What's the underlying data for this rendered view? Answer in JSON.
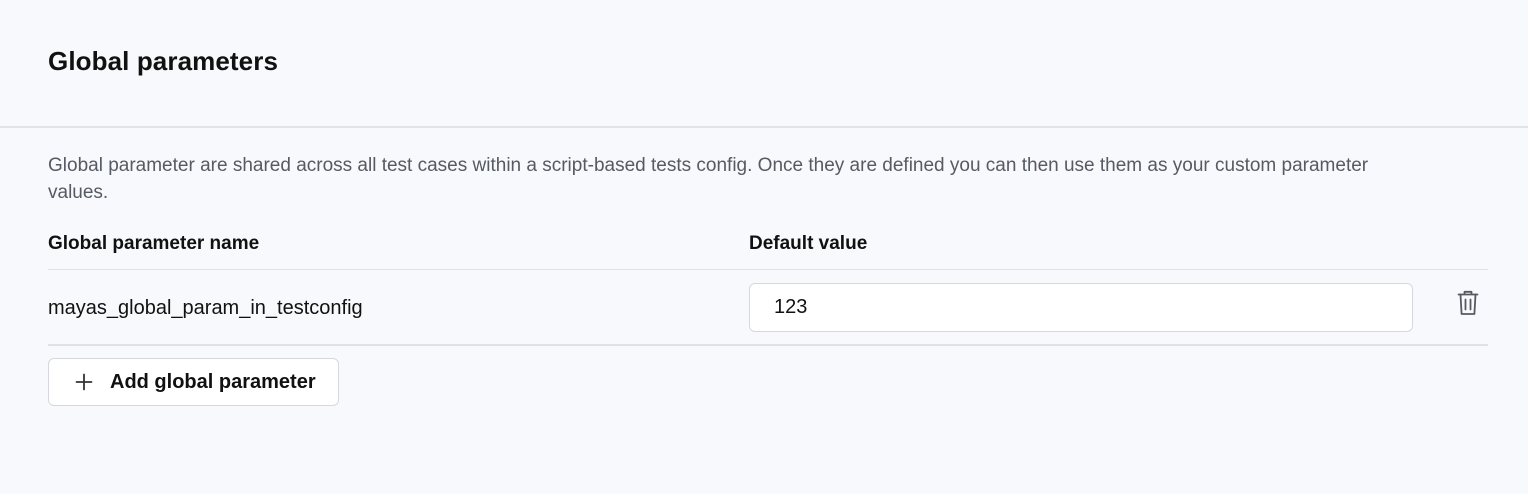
{
  "header": {
    "title": "Global parameters"
  },
  "description": "Global parameter are shared across all test cases within a script-based tests config. Once they are defined you can then use them as your custom parameter values.",
  "table": {
    "columns": [
      "Global parameter name",
      "Default value"
    ],
    "rows": [
      {
        "name": "mayas_global_param_in_testconfig",
        "default_value": "123",
        "delete_icon": "trash-icon"
      }
    ]
  },
  "add_button": {
    "icon": "plus-icon",
    "label": "Add global parameter"
  }
}
